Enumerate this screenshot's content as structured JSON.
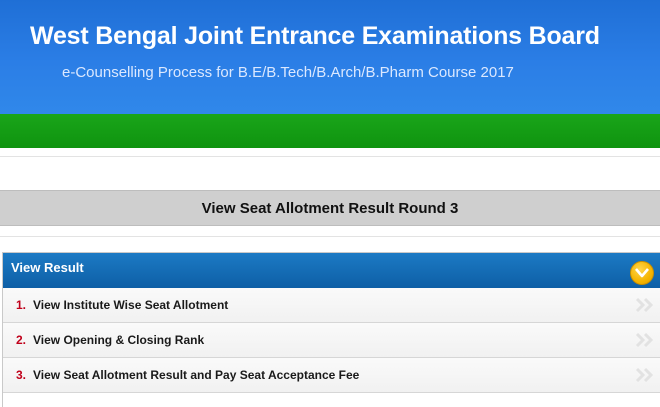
{
  "header": {
    "title": "West Bengal Joint Entrance Examinations Board",
    "subtitle": "e-Counselling Process for B.E/B.Tech/B.Arch/B.Pharm Course 2017"
  },
  "page_heading": "View Seat Allotment Result Round 3",
  "panel": {
    "title": "View Result",
    "toggle_icon": "chevron-down-circle-icon",
    "items": [
      {
        "number": "1.",
        "label": "View Institute Wise Seat Allotment"
      },
      {
        "number": "2.",
        "label": "View Opening & Closing Rank"
      },
      {
        "number": "3.",
        "label": "View Seat Allotment Result and Pay Seat Acceptance Fee"
      }
    ]
  },
  "colors": {
    "header_blue": "#2b7ee6",
    "green_bar": "#13991a",
    "panel_header": "#1570b8",
    "number_red": "#c0001a",
    "toggle_yellow": "#f5b400"
  }
}
